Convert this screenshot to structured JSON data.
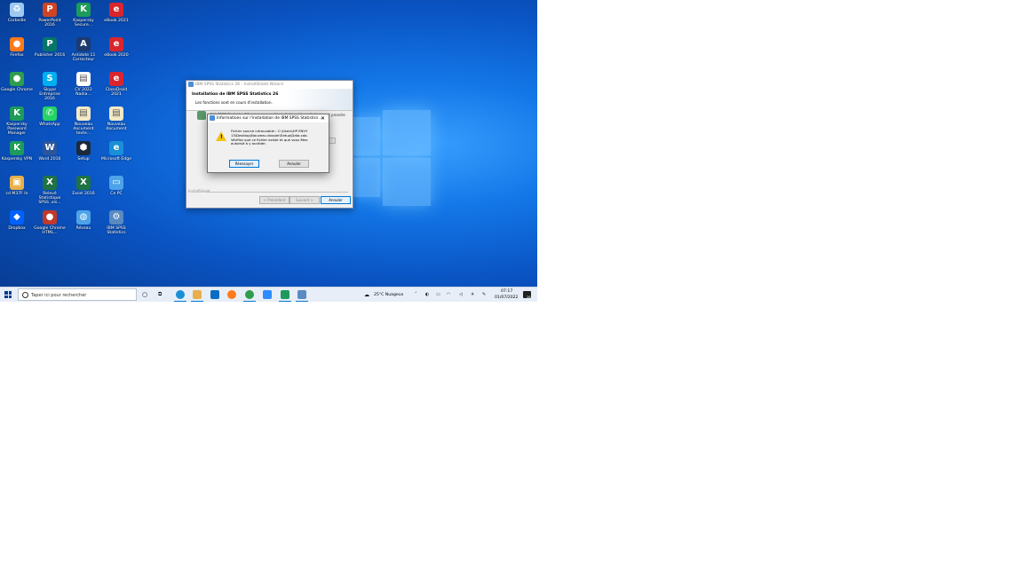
{
  "desktop": {
    "icons": [
      {
        "label": "Corbeille",
        "glyph": "♻",
        "color": "#9ec9f0"
      },
      {
        "label": "PowerPoint 2016",
        "glyph": "P",
        "color": "#d04423"
      },
      {
        "label": "Kaspersky Secure...",
        "glyph": "K",
        "color": "#1e9b5a"
      },
      {
        "label": "eBook 2021",
        "glyph": "e",
        "color": "#d9262e"
      },
      {
        "label": "Firefox",
        "glyph": "●",
        "color": "#ff7a1a"
      },
      {
        "label": "Publisher 2016",
        "glyph": "P",
        "color": "#077568"
      },
      {
        "label": "Antidote 11 Correcteur",
        "glyph": "A",
        "color": "#1d3a6e"
      },
      {
        "label": "eBook 2020",
        "glyph": "e",
        "color": "#d9262e"
      },
      {
        "label": "Google Chrome",
        "glyph": "●",
        "color": "#2e9d4e"
      },
      {
        "label": "Skype Entreprise 2016",
        "glyph": "S",
        "color": "#00aff0"
      },
      {
        "label": "CV 2022 Nadia...",
        "glyph": "▤",
        "color": "#ffffff"
      },
      {
        "label": "ClassDroid 2021",
        "glyph": "e",
        "color": "#d9262e"
      },
      {
        "label": "Kaspersky Password Manager",
        "glyph": "K",
        "color": "#1e9b5a"
      },
      {
        "label": "WhatsApp",
        "glyph": "✆",
        "color": "#25d366"
      },
      {
        "label": "Nouveau document texte...",
        "glyph": "▤",
        "color": "#f3e9c6"
      },
      {
        "label": "Nouveau document",
        "glyph": "▤",
        "color": "#f3e9c6"
      },
      {
        "label": "Kaspersky VPN",
        "glyph": "K",
        "color": "#1e9b5a"
      },
      {
        "label": "Word 2016",
        "glyph": "W",
        "color": "#2b579a"
      },
      {
        "label": "Setup",
        "glyph": "⬢",
        "color": "#1b2a3a"
      },
      {
        "label": "Microsoft Edge",
        "glyph": "e",
        "color": "#1a8fd6"
      },
      {
        "label": "cd M37F In",
        "glyph": "▣",
        "color": "#e8b04a"
      },
      {
        "label": "Relevé Statistique SPSS .xls...",
        "glyph": "X",
        "color": "#1f7244"
      },
      {
        "label": "Excel 2016",
        "glyph": "X",
        "color": "#1f7244"
      },
      {
        "label": "Ce PC",
        "glyph": "▭",
        "color": "#4da3e8"
      },
      {
        "label": "Dropbox",
        "glyph": "◆",
        "color": "#0061fe"
      },
      {
        "label": "Google Chrome HTML...",
        "glyph": "●",
        "color": "#c0392b"
      },
      {
        "label": "Réseau",
        "glyph": "◍",
        "color": "#4da3e8"
      },
      {
        "label": "IBM SPSS Statistics",
        "glyph": "⚙",
        "color": "#5a8ac2"
      }
    ]
  },
  "installer": {
    "title": "IBM SPSS Statistics 26 - InstallShield Wizard",
    "header_title": "Installation de IBM SPSS Statistics 26",
    "header_subtitle": "Les fonctions sont en cours d'installation.",
    "status_line": "IBM SPSS Statistics 26 est en cours d'installation. L'installation peut prendre",
    "installshield_label": "InstallShield",
    "back_label": "< Précédent",
    "next_label": "Suivant >",
    "cancel_label": "Annuler",
    "progress": 0.0
  },
  "dialog": {
    "title": "Informations sur l'installation de IBM SPSS Statistics ...",
    "close_glyph": "✕",
    "message": "Fichier source introuvable : C:\\Users\\HP ENVY 13\\Desktop\\Nouveau dossier\\Setup\\Data.cab. Vérifiez que ce fichier existe et que vous êtes autorisé à y accéder.",
    "retry_label": "Réessayer",
    "cancel_label": "Annuler"
  },
  "taskbar": {
    "search_placeholder": "Taper ici pour rechercher",
    "weather": "25°C Nuageux",
    "time": "07:17",
    "date": "01/07/2022",
    "notification_count": "26"
  },
  "colors": {
    "accent": "#0078d7",
    "desktop_blue": "#0a54c4",
    "taskbar_bg": "#e7eef8"
  }
}
